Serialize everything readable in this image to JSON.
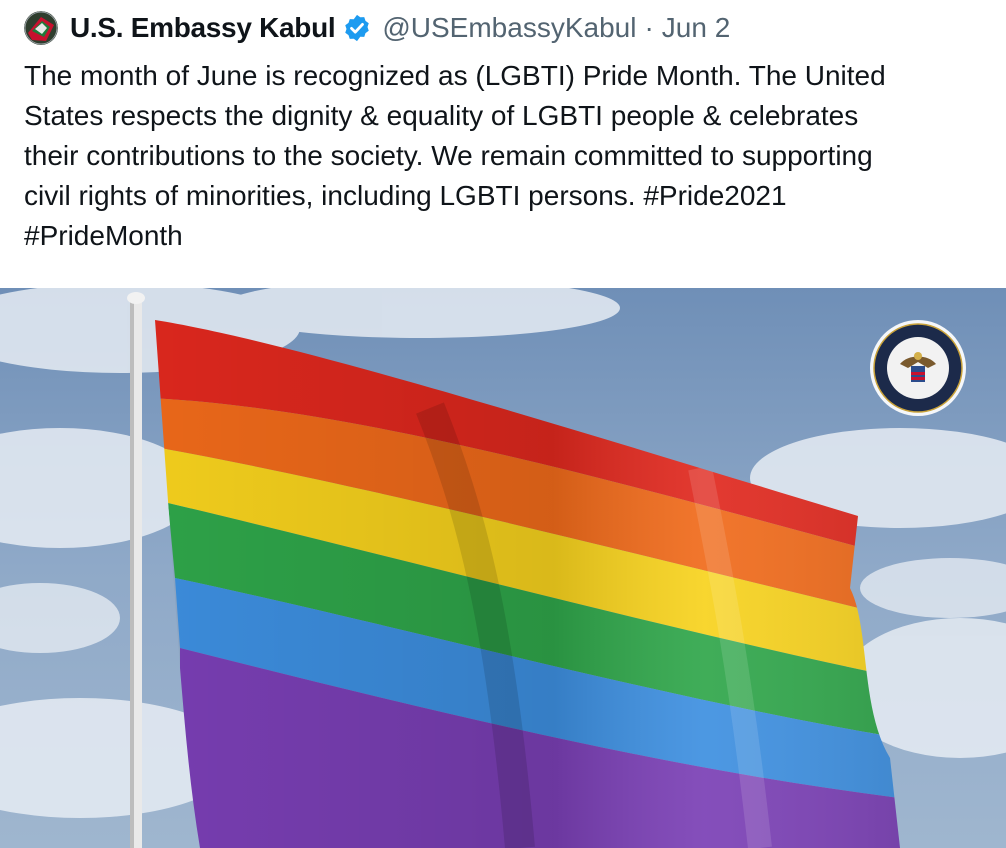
{
  "tweet": {
    "author": {
      "display_name": "U.S. Embassy Kabul",
      "handle": "@USEmbassyKabul",
      "verified": true,
      "avatar_icon": "embassy-avatar-icon"
    },
    "separator": "·",
    "timestamp": "Jun 2",
    "text_lines": [
      "The month of June is recognized as (LGBTI) Pride Month. The United",
      "States respects the dignity & equality of LGBTI people & celebrates",
      "their contributions to the society. We remain committed to supporting",
      "civil rights of minorities, including LGBTI persons. #Pride2021",
      "#PrideMonth"
    ],
    "media": {
      "type": "photo",
      "subject": "rainbow-flag-image",
      "seal_icon": "department-of-state-seal-icon",
      "stripe_colors": [
        "#e0281e",
        "#f06a1a",
        "#f7d21d",
        "#2fa64a",
        "#3d8fe0",
        "#7a3fb5"
      ]
    },
    "colors": {
      "text": "#0f1419",
      "secondary": "#536471",
      "verified": "#1d9bf0"
    }
  }
}
